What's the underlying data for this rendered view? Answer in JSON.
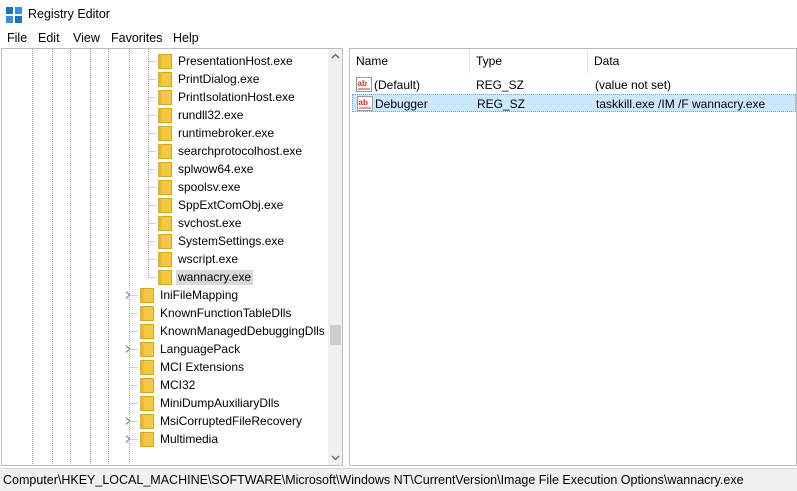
{
  "window": {
    "title": "Registry Editor"
  },
  "menu": [
    "File",
    "Edit",
    "View",
    "Favorites",
    "Help"
  ],
  "tree": {
    "items": [
      {
        "label": "PresentationHost.exe",
        "expandable": false,
        "selected": false
      },
      {
        "label": "PrintDialog.exe",
        "expandable": false,
        "selected": false
      },
      {
        "label": "PrintIsolationHost.exe",
        "expandable": false,
        "selected": false
      },
      {
        "label": "rundll32.exe",
        "expandable": false,
        "selected": false
      },
      {
        "label": "runtimebroker.exe",
        "expandable": false,
        "selected": false
      },
      {
        "label": "searchprotocolhost.exe",
        "expandable": false,
        "selected": false
      },
      {
        "label": "splwow64.exe",
        "expandable": false,
        "selected": false
      },
      {
        "label": "spoolsv.exe",
        "expandable": false,
        "selected": false
      },
      {
        "label": "SppExtComObj.exe",
        "expandable": false,
        "selected": false
      },
      {
        "label": "svchost.exe",
        "expandable": false,
        "selected": false
      },
      {
        "label": "SystemSettings.exe",
        "expandable": false,
        "selected": false
      },
      {
        "label": "wscript.exe",
        "expandable": false,
        "selected": false
      },
      {
        "label": "wannacry.exe",
        "expandable": false,
        "selected": true
      },
      {
        "label": "IniFileMapping",
        "expandable": true,
        "selected": false
      },
      {
        "label": "KnownFunctionTableDlls",
        "expandable": false,
        "selected": false
      },
      {
        "label": "KnownManagedDebuggingDlls",
        "expandable": false,
        "selected": false
      },
      {
        "label": "LanguagePack",
        "expandable": true,
        "selected": false
      },
      {
        "label": "MCI Extensions",
        "expandable": false,
        "selected": false
      },
      {
        "label": "MCI32",
        "expandable": false,
        "selected": false
      },
      {
        "label": "MiniDumpAuxiliaryDlls",
        "expandable": false,
        "selected": false
      },
      {
        "label": "MsiCorruptedFileRecovery",
        "expandable": true,
        "selected": false
      },
      {
        "label": "Multimedia",
        "expandable": true,
        "selected": false
      }
    ]
  },
  "values": {
    "headers": {
      "name": "Name",
      "type": "Type",
      "data": "Data"
    },
    "rows": [
      {
        "name": "(Default)",
        "type": "REG_SZ",
        "data": "(value not set)",
        "selected": false
      },
      {
        "name": "Debugger",
        "type": "REG_SZ",
        "data": "taskkill.exe /IM /F wannacry.exe",
        "selected": true
      }
    ]
  },
  "status": {
    "path": "Computer\\HKEY_LOCAL_MACHINE\\SOFTWARE\\Microsoft\\Windows NT\\CurrentVersion\\Image File Execution Options\\wannacry.exe"
  },
  "colors": {
    "selection": "#cce8ff",
    "folder": "#f5c842",
    "tree_selected": "#d9d9d9"
  }
}
